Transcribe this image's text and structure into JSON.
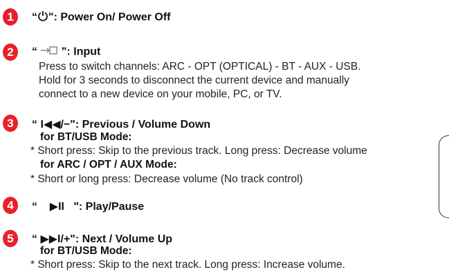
{
  "items": [
    {
      "number": "1",
      "heading_prefix": "“",
      "heading_icon": "power-icon",
      "heading_suffix": "\": Power On/ Power Off"
    },
    {
      "number": "2",
      "heading_prefix": "“ ",
      "heading_icon": "input-icon",
      "heading_suffix": " \": Input",
      "lines": [
        "Press to switch channels: ARC - OPT (OPTICAL) - BT - AUX - USB.",
        "Hold for 3 seconds to disconnect the current device and manually",
        "connect to a new device on your mobile, PC, or TV."
      ]
    },
    {
      "number": "3",
      "heading": "“ I◀◀/−\": Previous / Volume Down",
      "mode1": "for BT/USB Mode:",
      "mode1_line": "* Short press: Skip to the previous track. Long press: Decrease volume",
      "mode2": "for ARC / OPT / AUX Mode:",
      "mode2_line": "* Short or long press: Decrease volume (No track control)"
    },
    {
      "number": "4",
      "heading": "“    ▶II   \": Play/Pause"
    },
    {
      "number": "5",
      "heading": "“ ▶▶I/+\": Next / Volume Up",
      "mode1": "for BT/USB Mode:",
      "mode1_line": "* Short press: Skip to the next track. Long press: Increase volume."
    }
  ]
}
